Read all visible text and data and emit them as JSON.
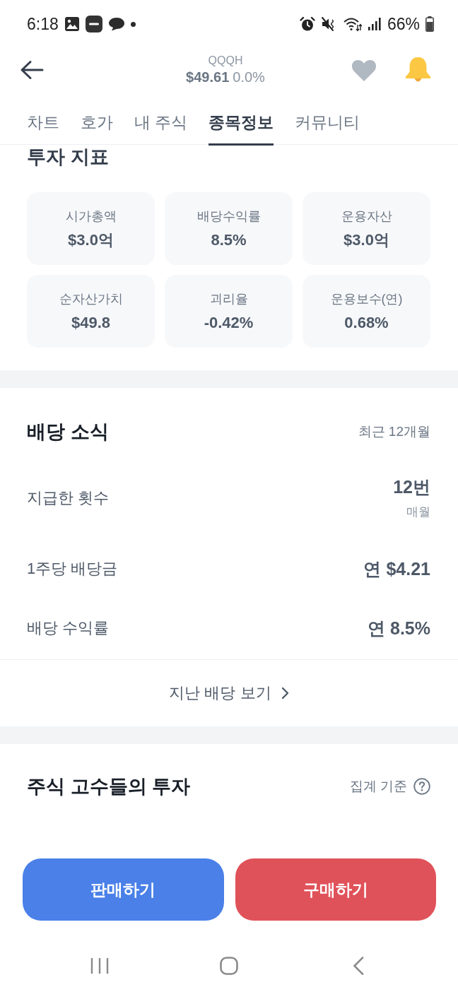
{
  "status_bar": {
    "time": "6:18",
    "battery": "66%"
  },
  "header": {
    "ticker": "QQQH",
    "price": "$49.61",
    "change": "0.0%",
    "favorited": false
  },
  "tabs": [
    {
      "label": "차트",
      "selected": false
    },
    {
      "label": "호가",
      "selected": false
    },
    {
      "label": "내 주식",
      "selected": false
    },
    {
      "label": "종목정보",
      "selected": true
    },
    {
      "label": "커뮤니티",
      "selected": false
    }
  ],
  "indicators": {
    "title": "투자 지표",
    "cards": [
      {
        "label": "시가총액",
        "value": "$3.0억"
      },
      {
        "label": "배당수익률",
        "value": "8.5%"
      },
      {
        "label": "운용자산",
        "value": "$3.0억"
      },
      {
        "label": "순자산가치",
        "value": "$49.8"
      },
      {
        "label": "괴리율",
        "value": "-0.42%"
      },
      {
        "label": "운용보수(연)",
        "value": "0.68%"
      }
    ]
  },
  "dividend": {
    "title": "배당 소식",
    "period": "최근 12개월",
    "rows": [
      {
        "label": "지급한 횟수",
        "value": "12번",
        "note": "매월"
      },
      {
        "label": "1주당 배당금",
        "value": "연 $4.21"
      },
      {
        "label": "배당 수익률",
        "value": "연 8.5%"
      }
    ],
    "more_link": "지난 배당 보기"
  },
  "experts": {
    "title": "주식 고수들의 투자",
    "basis": "집계 기준"
  },
  "actions": [
    {
      "kind": "sell",
      "label": "판매하기"
    },
    {
      "kind": "buy",
      "label": "구매하기"
    }
  ]
}
